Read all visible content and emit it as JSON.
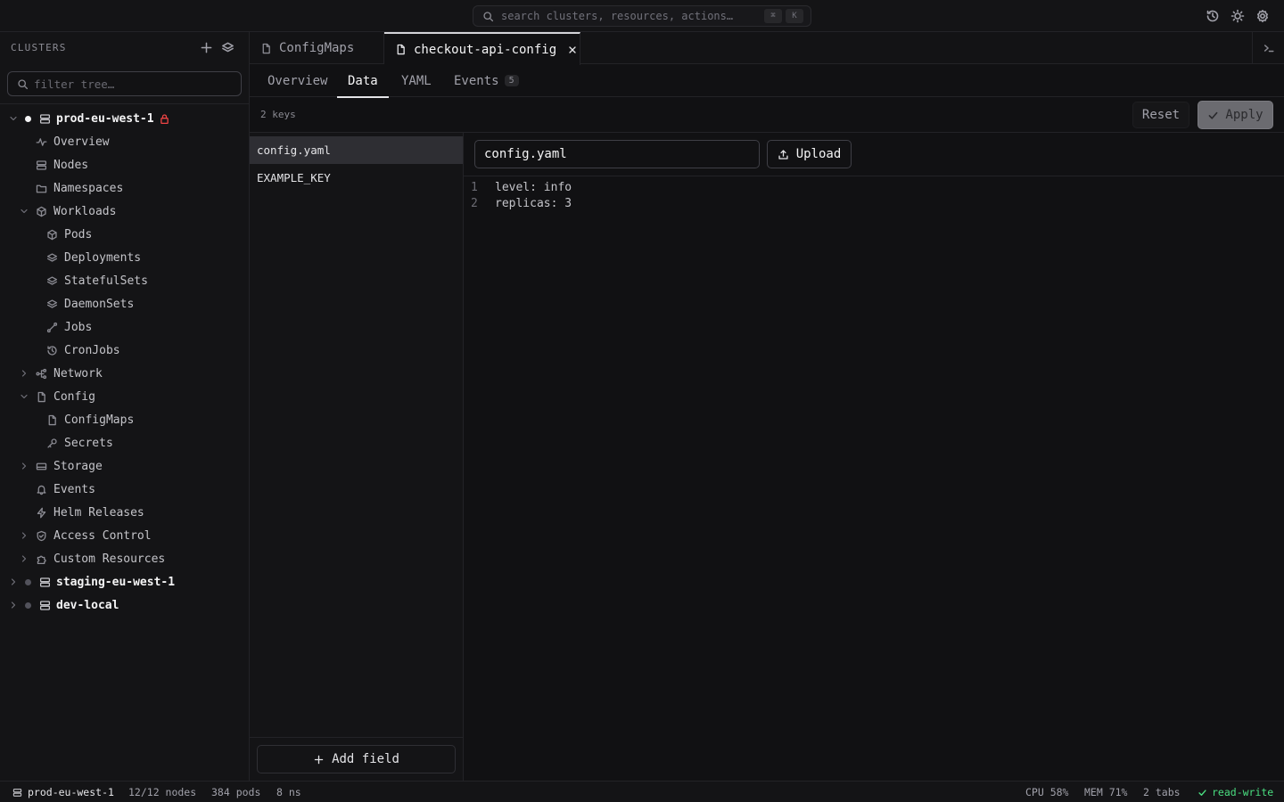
{
  "topbar": {
    "search_placeholder": "search clusters, resources, actions…",
    "shortcut_keys": [
      "⌘",
      "K"
    ],
    "icons": [
      "history-icon",
      "theme-sun-icon",
      "settings-gear-icon"
    ]
  },
  "sidebar": {
    "header": "CLUSTERS",
    "filter_placeholder": "filter tree…",
    "tree": [
      {
        "label": "prod-eu-west-1",
        "type": "cluster",
        "expanded": true,
        "status_color": "#f4f4f5",
        "locked": true,
        "lock_color": "#ef4444"
      },
      {
        "label": "Overview",
        "icon": "activity-icon"
      },
      {
        "label": "Nodes",
        "icon": "server-icon"
      },
      {
        "label": "Namespaces",
        "icon": "folder-icon"
      },
      {
        "label": "Workloads",
        "icon": "cube-icon",
        "expanded": true
      },
      {
        "label": "Pods",
        "icon": "cube-icon"
      },
      {
        "label": "Deployments",
        "icon": "layers-icon"
      },
      {
        "label": "StatefulSets",
        "icon": "layers-icon"
      },
      {
        "label": "DaemonSets",
        "icon": "layers-icon"
      },
      {
        "label": "Jobs",
        "icon": "workflow-icon"
      },
      {
        "label": "CronJobs",
        "icon": "history-icon"
      },
      {
        "label": "Network",
        "icon": "network-icon",
        "expanded": false
      },
      {
        "label": "Config",
        "icon": "file-icon",
        "expanded": true
      },
      {
        "label": "ConfigMaps",
        "icon": "file-icon"
      },
      {
        "label": "Secrets",
        "icon": "key-icon"
      },
      {
        "label": "Storage",
        "icon": "drive-icon",
        "expanded": false
      },
      {
        "label": "Events",
        "icon": "bell-icon"
      },
      {
        "label": "Helm Releases",
        "icon": "zap-icon"
      },
      {
        "label": "Access Control",
        "icon": "shield-icon",
        "expanded": false
      },
      {
        "label": "Custom Resources",
        "icon": "puzzle-icon",
        "expanded": false
      },
      {
        "label": "staging-eu-west-1",
        "type": "cluster",
        "expanded": false,
        "status_color": "#52525b"
      },
      {
        "label": "dev-local",
        "type": "cluster",
        "expanded": false,
        "status_color": "#52525b"
      }
    ]
  },
  "tabs": [
    {
      "label": "ConfigMaps",
      "active": false
    },
    {
      "label": "checkout-api-config",
      "active": true
    }
  ],
  "subtabs": [
    {
      "label": "Overview",
      "active": false
    },
    {
      "label": "Data",
      "active": true
    },
    {
      "label": "YAML",
      "active": false
    },
    {
      "label": "Events",
      "active": false,
      "badge": "5"
    }
  ],
  "toolbar": {
    "keys_count": "2 keys",
    "reset_label": "Reset",
    "apply_label": "Apply"
  },
  "keys": [
    {
      "name": "config.yaml",
      "selected": true
    },
    {
      "name": "EXAMPLE_KEY",
      "selected": false
    }
  ],
  "add_field_label": "Add field",
  "editor": {
    "key_name": "config.yaml",
    "upload_label": "Upload",
    "lines": [
      {
        "num": "1",
        "text": "level: info"
      },
      {
        "num": "2",
        "text": "replicas: 3"
      }
    ]
  },
  "statusbar": {
    "cluster": "prod-eu-west-1",
    "nodes": "12/12 nodes",
    "pods": "384 pods",
    "namespaces": "8 ns",
    "cpu": "CPU 58%",
    "mem": "MEM 71%",
    "tabs": "2 tabs",
    "mode": "read-write",
    "mode_color": "#4ade80"
  }
}
